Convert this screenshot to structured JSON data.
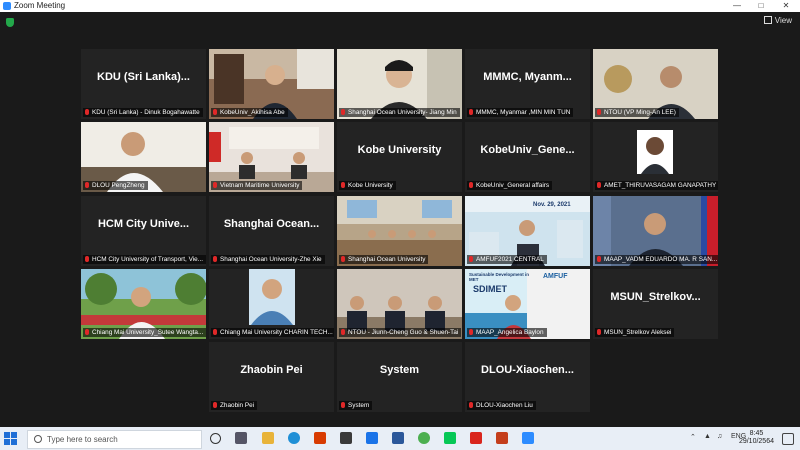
{
  "window": {
    "title": "Zoom Meeting",
    "view_label": "View"
  },
  "tiles": [
    {
      "big": "KDU (Sri Lanka)...",
      "caption": "KDU (Sri Lanka) - Dinuk Bogahawatte"
    },
    {
      "big": "",
      "caption": "KobeUniv_Akihisa Abe"
    },
    {
      "big": "",
      "caption": "Shanghai Ocean University- Jiang Min"
    },
    {
      "big": "MMMC, Myanm...",
      "caption": "MMMC, Myanmar ,MIN MIN TUN"
    },
    {
      "big": "",
      "caption": "NTOU (VP Ming-An LEE)"
    },
    {
      "big": "",
      "caption": "DLOU PengZheng"
    },
    {
      "big": "",
      "caption": "Vietnam Maritime University"
    },
    {
      "big": "Kobe University",
      "caption": "Kobe University"
    },
    {
      "big": "KobeUniv_Gene...",
      "caption": "KobeUniv_General affairs"
    },
    {
      "big": "",
      "caption": "AMET_THIRUVASAGAM GANAPATHY"
    },
    {
      "big": "HCM City Unive...",
      "caption": "HCM City University of Transport, Vie..."
    },
    {
      "big": "Shanghai Ocean...",
      "caption": "Shanghai Ocean University-Zhe Xie"
    },
    {
      "big": "",
      "caption": "Shanghai Ocean University"
    },
    {
      "big": "",
      "caption": "AMFUF2021 CENTRAL"
    },
    {
      "big": "",
      "caption": "MAAP_VADM EDUARDO MA. R SAN..."
    },
    {
      "big": "",
      "caption": "Chiang Mai University_Sutee Wangta..."
    },
    {
      "big": "",
      "caption": "Chiang Mai University CHARIN TECH..."
    },
    {
      "big": "",
      "caption": "NTOU - Jiunn-Cheng Guo & Shuen-Tai"
    },
    {
      "big": "",
      "caption": "MAAP_Angelica Baylon"
    },
    {
      "big": "MSUN_Strelkov...",
      "caption": "MSUN_Strelkov Aleksei"
    },
    {
      "big": "Zhaobin Pei",
      "caption": "Zhaobin Pei"
    },
    {
      "big": "System",
      "caption": "System"
    },
    {
      "big": "DLOU-Xiaochen...",
      "caption": "DLOU-Xiaochen Liu"
    }
  ],
  "screen_text": {
    "banner_date": "Nov. 29, 2021",
    "slide_title": "Sustainable Development in MET",
    "slide_brand": "SDIMET",
    "slide_logo": "AMFUF"
  },
  "taskbar": {
    "search_placeholder": "Type here to search",
    "time": "8:45",
    "date": "29/10/2564",
    "lang": "ENG"
  },
  "colors": {
    "active_speaker": "#7ac943",
    "mic_muted": "#e02828",
    "taskbar": "#e8eef6"
  }
}
